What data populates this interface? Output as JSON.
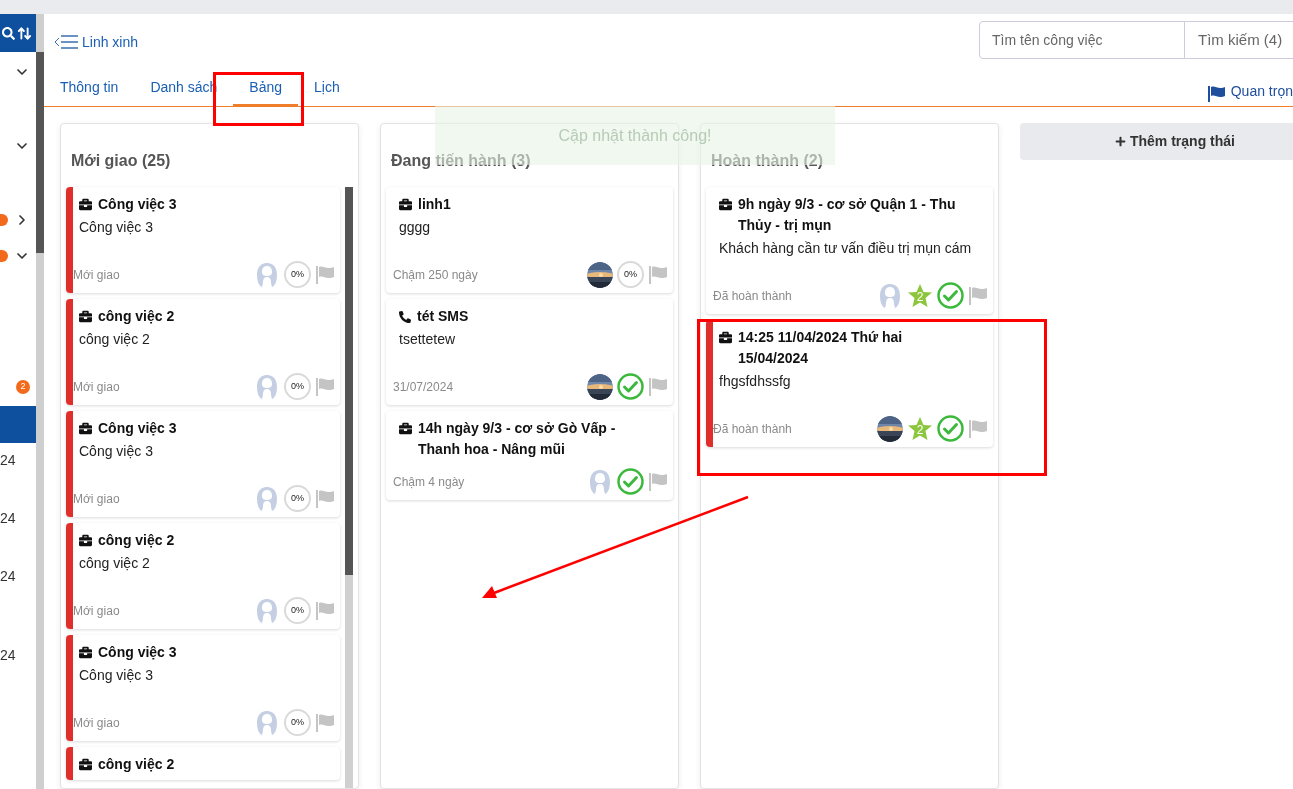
{
  "sidebar": {
    "items": [
      {
        "kind": "group",
        "expanded": true,
        "dot": false
      },
      {
        "kind": "group",
        "expanded": true,
        "dot": false
      },
      {
        "kind": "group",
        "expanded": false,
        "dot": true
      },
      {
        "kind": "group",
        "expanded": true,
        "dot": true
      },
      {
        "kind": "badge",
        "badge": "2"
      },
      {
        "kind": "item",
        "selected": true
      },
      {
        "kind": "item",
        "selected": false,
        "text": "24"
      },
      {
        "kind": "item",
        "selected": false,
        "text": "24"
      },
      {
        "kind": "item",
        "selected": false,
        "text": "24"
      },
      {
        "kind": "item",
        "selected": false,
        "text": "24"
      }
    ]
  },
  "header": {
    "back_label": "Linh xinh",
    "search": {
      "placeholder": "Tìm tên công việc"
    },
    "search_button": "Tìm kiếm (4)"
  },
  "tabs": [
    {
      "label": "Thông tin",
      "selected": false
    },
    {
      "label": "Danh sách",
      "selected": false
    },
    {
      "label": "Bảng",
      "selected": true
    },
    {
      "label": "Lịch",
      "selected": false
    }
  ],
  "important_filter": "Quan trọn",
  "toast": {
    "message": "Cập nhật thành công!"
  },
  "columns": [
    {
      "title": "Mới giao (25)",
      "scrollbar": true,
      "cards": [
        {
          "kind": "task",
          "title": "Công việc 3",
          "description": "Công việc 3",
          "status": "Mới giao",
          "marked": true,
          "important": false,
          "has_photo": false,
          "badges": [
            {
              "kind": "progress",
              "text": "0%"
            }
          ]
        },
        {
          "kind": "task",
          "title": "công việc 2",
          "description": "công việc 2",
          "status": "Mới giao",
          "marked": true,
          "important": false,
          "has_photo": false,
          "badges": [
            {
              "kind": "progress",
              "text": "0%"
            }
          ]
        },
        {
          "kind": "task",
          "title": "Công việc 3",
          "description": "Công việc 3",
          "status": "Mới giao",
          "marked": true,
          "important": false,
          "has_photo": false,
          "badges": [
            {
              "kind": "progress",
              "text": "0%"
            }
          ]
        },
        {
          "kind": "task",
          "title": "công việc 2",
          "description": "công việc 2",
          "status": "Mới giao",
          "marked": true,
          "important": false,
          "has_photo": false,
          "badges": [
            {
              "kind": "progress",
              "text": "0%"
            }
          ]
        },
        {
          "kind": "task",
          "title": "Công việc 3",
          "description": "Công việc 3",
          "status": "Mới giao",
          "marked": true,
          "important": false,
          "has_photo": false,
          "badges": [
            {
              "kind": "progress",
              "text": "0%"
            }
          ]
        },
        {
          "kind": "task",
          "title": "công việc 2",
          "marked": true
        }
      ]
    },
    {
      "title": "Đang tiến hành (3)",
      "scrollbar": false,
      "cards": [
        {
          "kind": "task",
          "title": "linh1",
          "description": "gggg",
          "status": "Chậm 250 ngày",
          "marked": false,
          "important": false,
          "has_photo": true,
          "badges": [
            {
              "kind": "progress",
              "text": "0%"
            }
          ]
        },
        {
          "kind": "call",
          "title": "tét SMS",
          "description": "tsettetew",
          "status": "31/07/2024",
          "marked": false,
          "important": false,
          "has_photo": true,
          "badges": [
            {
              "kind": "done"
            }
          ]
        },
        {
          "kind": "task",
          "title": "14h ngày 9/3 - cơ sở Gò Vấp - Thanh hoa - Nâng mũi",
          "status": "Chậm 4 ngày",
          "marked": false,
          "important": false,
          "has_photo": false,
          "badges": [
            {
              "kind": "done"
            }
          ]
        }
      ]
    },
    {
      "title": "Hoàn thành (2)",
      "scrollbar": false,
      "cards": [
        {
          "kind": "task",
          "title": "9h ngày 9/3 - cơ sở Quận 1 - Thu Thủy - trị mụn",
          "description": "Khách hàng cần tư vấn điều trị mụn cám",
          "status": "Đã hoàn thành",
          "marked": false,
          "important": false,
          "has_photo": false,
          "badges": [
            {
              "kind": "star",
              "text": "2"
            },
            {
              "kind": "done"
            }
          ]
        },
        {
          "kind": "task",
          "title": "14:25 11/04/2024 Thứ hai 15/04/2024",
          "description": "fhgsfdhssfg",
          "status": "Đã hoàn thành",
          "marked": true,
          "important": false,
          "has_photo": true,
          "badges": [
            {
              "kind": "star",
              "text": "2"
            },
            {
              "kind": "done"
            }
          ]
        }
      ]
    }
  ],
  "add_status_button": "Thêm trạng thái"
}
